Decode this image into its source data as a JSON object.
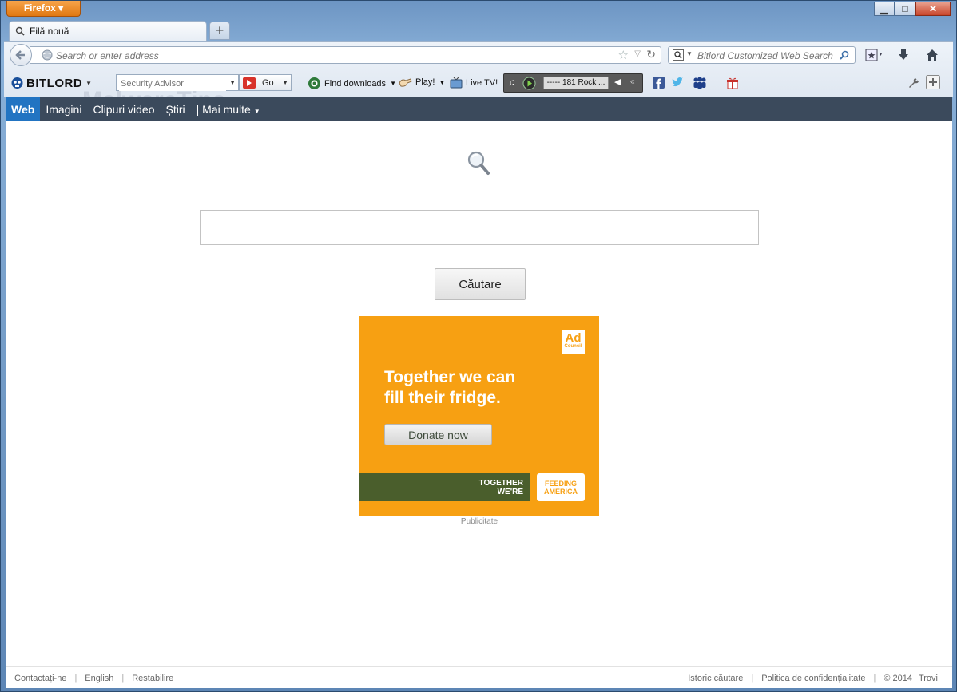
{
  "window": {
    "app_button": "Firefox",
    "controls": [
      "minimize",
      "maximize",
      "close"
    ]
  },
  "tab": {
    "label": "Filă nouă",
    "new_tab": "+"
  },
  "navbar": {
    "url_placeholder": "Search or enter address",
    "search_placeholder": "Bitlord Customized Web Search"
  },
  "watermark": "MalwareTips",
  "toolbar": {
    "brand": "BITLORD",
    "search_placeholder": "Security Advisor",
    "go_label": "Go",
    "find_downloads": "Find downloads",
    "play": "Play!",
    "live_tv": "Live TV!",
    "station": "----- 181 Rock ...",
    "colors": {
      "player_bg": "#5a5a5a",
      "go_red": "#d8322a"
    }
  },
  "webnav": {
    "items": [
      "Web",
      "Imagini",
      "Clipuri video",
      "Știri",
      "| Mai multe"
    ],
    "active": "Web",
    "colors": {
      "bar": "#3b4a5c",
      "active": "#2274c2"
    }
  },
  "main": {
    "search_button": "Căutare"
  },
  "ad": {
    "logo_top": "Ad",
    "logo_bottom": "Council",
    "headline_line1": "Together we can",
    "headline_line2": "fill their fridge.",
    "button": "Donate now",
    "band_line1": "TOGETHER",
    "band_line2": "WE'RE",
    "partner_line1": "FEEDING",
    "partner_line2": "AMERICA",
    "caption": "Publicitate",
    "colors": {
      "bg": "#f7a012",
      "band": "#4a5e2c"
    }
  },
  "footer": {
    "left": [
      "Contactați-ne",
      "English",
      "Restabilire"
    ],
    "right_history": "Istoric căutare",
    "right_privacy": "Politica de confidențialitate",
    "right_copy": "© 2014",
    "right_brand": "Trovi"
  }
}
